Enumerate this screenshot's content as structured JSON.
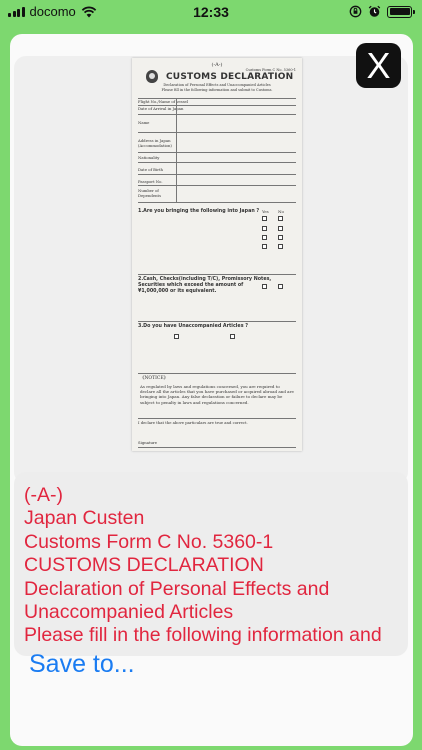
{
  "status_bar": {
    "carrier": "docomo",
    "time": "12:33"
  },
  "viewer": {
    "close_label": "X",
    "document": {
      "header": "(-A-)",
      "form_number": "Customs Form C No. 5360-1",
      "title": "CUSTOMS DECLARATION",
      "subtitle": "Declaration of Personal Effects and Unaccompanied Articles",
      "instruction": "Please fill in the following information and submit to Customs.",
      "fields": [
        "Flight No./Name of vessel",
        "Date of Arrival in Japan",
        "Name",
        "Address in Japan (Accommodation)",
        "Nationality",
        "Date of Birth",
        "Passport No.",
        "Number of Dependents"
      ],
      "questions": [
        "1.Are you bringing the following into Japan ?",
        "2.Cash, Checks(including T/C), Promissory Notes, Securities which exceed the amount of ¥1,000,000 or its equivalent.",
        "3.Do you have Unaccompanied Articles ?"
      ],
      "answer_labels": {
        "yes": "Yes",
        "no": "No"
      },
      "notice_title": "《NOTICE》",
      "notice_text": "As regulated by laws and regulations concerned, you are required to declare all the articles that you have purchased or acquired abroad and are bringing into Japan. Any false declaration or failure to declare may be subject to penalty in laws and regulations concerned.",
      "certify": "I declare that the above particulars are true and correct.",
      "signature_label": "Signature"
    }
  },
  "recognized_text": {
    "lines": [
      "(-A-)",
      "Japan Custen",
      "Customs Form C No. 5360-1",
      "CUSTOMS DECLARATION",
      "Declaration of Personal Effects and",
      "Unaccompanied Articles",
      "Please fill in the following information and"
    ]
  },
  "actions": {
    "save_label": "Save to..."
  },
  "colors": {
    "background": "#7dd86f",
    "ocr_text": "#e1263f",
    "link": "#1a7cf2"
  }
}
